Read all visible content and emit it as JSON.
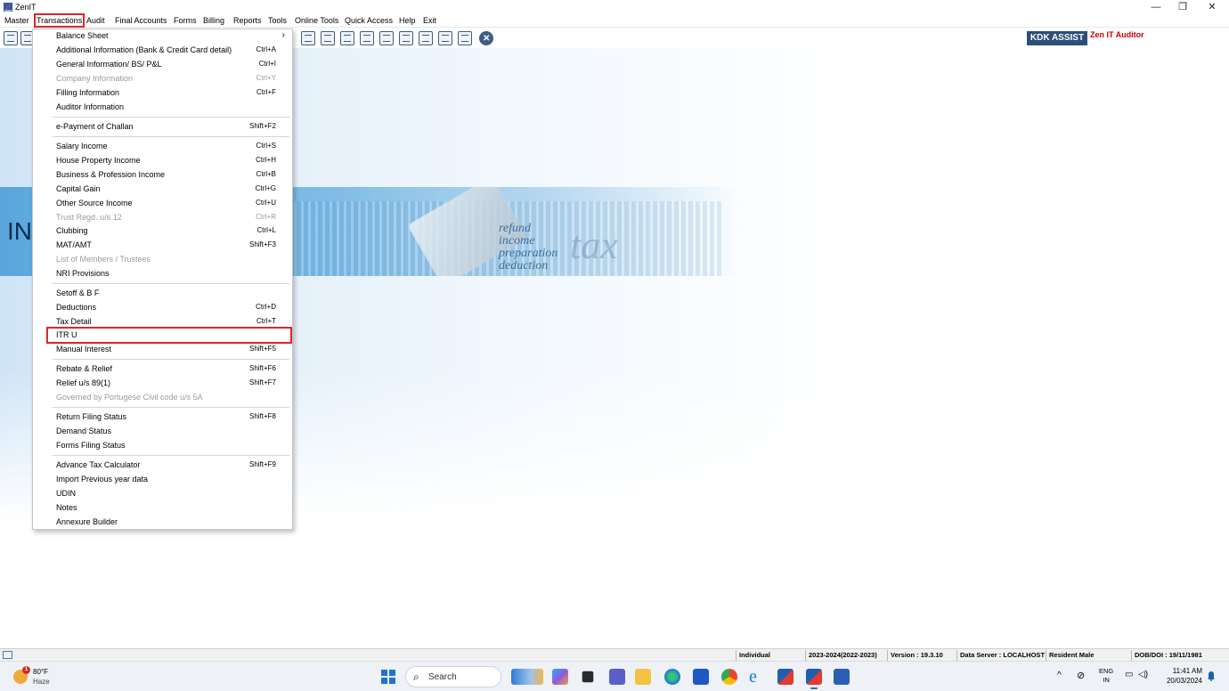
{
  "window": {
    "title": "ZenIT",
    "min_glyph": "—",
    "restore_glyph": "❐",
    "close_glyph": "✕"
  },
  "menubar": {
    "items": [
      "Master",
      "Transactions",
      "Audit",
      "Final Accounts",
      "Forms",
      "Billing",
      "Reports",
      "Tools",
      "Online Tools",
      "Quick Access",
      "Help",
      "Exit"
    ],
    "active": "Transactions"
  },
  "toolbar": {
    "icons": [
      "report-icon",
      "home-icon",
      "calculator-icon",
      "document-chart-icon",
      "calendar-icon",
      "tag-icon",
      "refresh-doc-icon",
      "board-icon",
      "grid-icon",
      "badge-icon",
      "form-icon",
      "close-circle-icon"
    ]
  },
  "header_right": {
    "kdk_assist": "KDK ASSIST",
    "product": "Zen IT Auditor"
  },
  "banner": {
    "text": "INC",
    "words": [
      "preparation",
      "deduction",
      "income",
      "refund"
    ],
    "big_word": "tax"
  },
  "transactions_menu": {
    "groups": [
      [
        {
          "label": "Balance Sheet",
          "shortcut": "",
          "submenu": true,
          "disabled": false
        },
        {
          "label": "Additional Information (Bank & Credit Card detail)",
          "shortcut": "Ctrl+A",
          "disabled": false
        },
        {
          "label": "General Information/ BS/ P&L",
          "shortcut": "Ctrl+I",
          "disabled": false
        },
        {
          "label": "Company Information",
          "shortcut": "Ctrl+Y",
          "disabled": true
        },
        {
          "label": "Filling Information",
          "shortcut": "Ctrl+F",
          "disabled": false
        },
        {
          "label": "Auditor Information",
          "shortcut": "",
          "disabled": false
        }
      ],
      [
        {
          "label": "e-Payment of Challan",
          "shortcut": "Shift+F2",
          "disabled": false
        }
      ],
      [
        {
          "label": "Salary Income",
          "shortcut": "Ctrl+S",
          "disabled": false
        },
        {
          "label": "House Property Income",
          "shortcut": "Ctrl+H",
          "disabled": false
        },
        {
          "label": "Business & Profession Income",
          "shortcut": "Ctrl+B",
          "disabled": false
        },
        {
          "label": "Capital Gain",
          "shortcut": "Ctrl+G",
          "disabled": false
        },
        {
          "label": "Other Source Income",
          "shortcut": "Ctrl+U",
          "disabled": false
        },
        {
          "label": "Trust Regd. u/s 12",
          "shortcut": "Ctrl+R",
          "disabled": true
        },
        {
          "label": "Clubbing",
          "shortcut": "Ctrl+L",
          "disabled": false
        },
        {
          "label": "MAT/AMT",
          "shortcut": "Shift+F3",
          "disabled": false
        },
        {
          "label": "List of Members / Trustees",
          "shortcut": "",
          "disabled": true
        },
        {
          "label": "NRI Provisions",
          "shortcut": "",
          "disabled": false
        }
      ],
      [
        {
          "label": "Setoff & B F",
          "shortcut": "",
          "disabled": false
        },
        {
          "label": "Deductions",
          "shortcut": "Ctrl+D",
          "disabled": false
        },
        {
          "label": "Tax Detail",
          "shortcut": "Ctrl+T",
          "disabled": false
        },
        {
          "label": "ITR U",
          "shortcut": "",
          "disabled": false,
          "highlighted": true
        },
        {
          "label": "Manual Interest",
          "shortcut": "Shift+F5",
          "disabled": false
        }
      ],
      [
        {
          "label": "Rebate & Relief",
          "shortcut": "Shift+F6",
          "disabled": false
        },
        {
          "label": "Relief u/s 89(1)",
          "shortcut": "Shift+F7",
          "disabled": false
        },
        {
          "label": "Governed by Portugese Civil code u/s 5A",
          "shortcut": "",
          "disabled": true
        }
      ],
      [
        {
          "label": "Return Filing Status",
          "shortcut": "Shift+F8",
          "disabled": false
        },
        {
          "label": "Demand Status",
          "shortcut": "",
          "disabled": false
        },
        {
          "label": "Forms Filing Status",
          "shortcut": "",
          "disabled": false
        }
      ],
      [
        {
          "label": "Advance Tax Calculator",
          "shortcut": "Shift+F9",
          "disabled": false
        },
        {
          "label": "Import Previous year data",
          "shortcut": "",
          "disabled": false
        },
        {
          "label": "UDIN",
          "shortcut": "",
          "disabled": false
        },
        {
          "label": "Notes",
          "shortcut": "",
          "disabled": false
        },
        {
          "label": "Annexure Builder",
          "shortcut": "",
          "disabled": false
        }
      ]
    ]
  },
  "statusbar": {
    "status_type": "Individual",
    "assessment_year": "2023-2024(2022-2023)",
    "version": "Version : 19.3.10",
    "data_server": "Data Server : LOCALHOST",
    "residency": "Resident Male",
    "dob": "DOB/DOI : 19/11/1981"
  },
  "taskbar": {
    "weather_temp": "80°F",
    "weather_cond": "Haze",
    "weather_badge": "1",
    "search_placeholder": "Search",
    "apps": [
      "widgets-icon",
      "copilot-icon",
      "explorer-dark-icon",
      "teams-icon",
      "file-explorer-icon",
      "edge-icon",
      "store-icon",
      "chrome-icon",
      "ie-icon",
      "zenit-icon",
      "zenit-active-icon",
      "word-icon"
    ],
    "tray_chevron": "^",
    "lang_top": "ENG",
    "lang_bottom": "IN",
    "time": "11:41 AM",
    "date": "20/03/2024"
  },
  "colors": {
    "highlight_red": "#e0232e",
    "kdk_blue": "#2b4f78",
    "zen_red": "#cc0000",
    "toolbar_icon": "#3b5f86"
  }
}
